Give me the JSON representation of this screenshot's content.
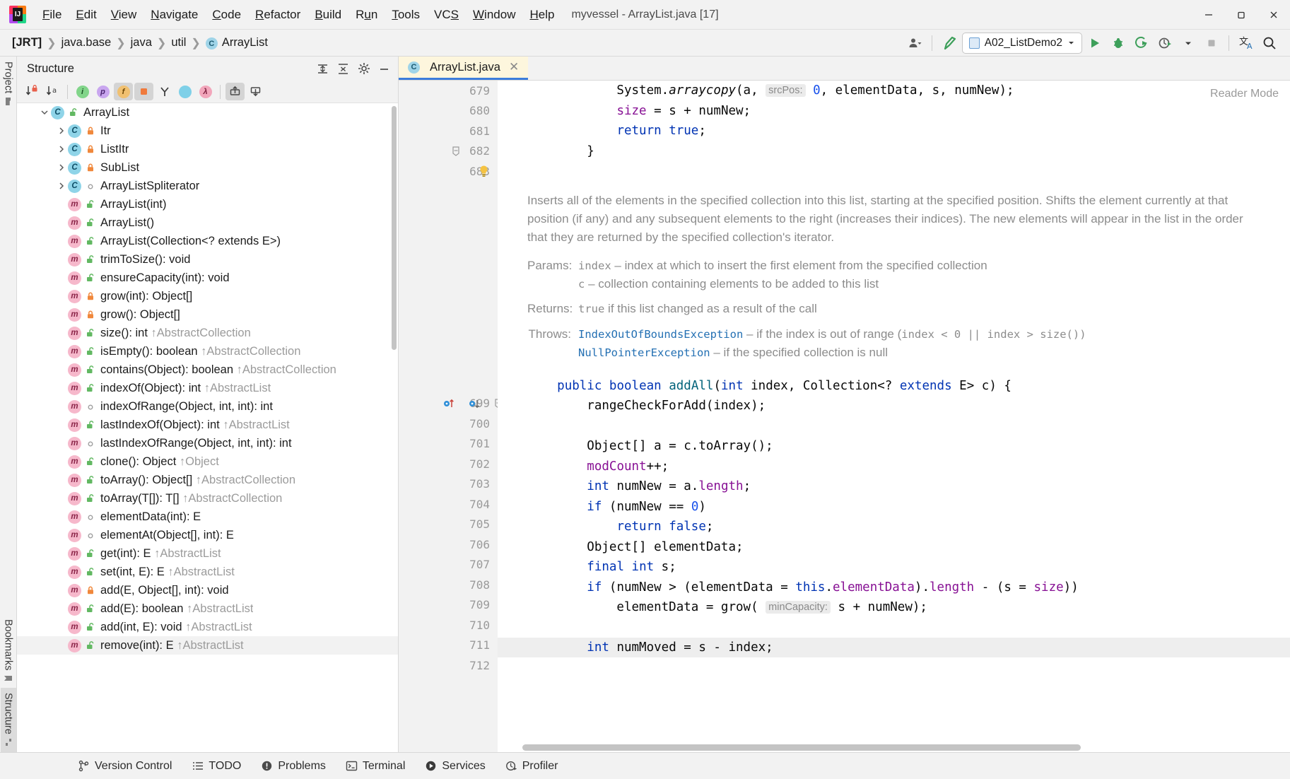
{
  "window": {
    "title": "myvessel - ArrayList.java [17]",
    "minimize": "minimize-icon",
    "restore": "restore-icon",
    "close": "close-icon"
  },
  "menubar": [
    {
      "label": "File",
      "mnemonic": "F"
    },
    {
      "label": "Edit",
      "mnemonic": "E"
    },
    {
      "label": "View",
      "mnemonic": "V"
    },
    {
      "label": "Navigate",
      "mnemonic": "N"
    },
    {
      "label": "Code",
      "mnemonic": "C"
    },
    {
      "label": "Refactor",
      "mnemonic": "R"
    },
    {
      "label": "Build",
      "mnemonic": "B"
    },
    {
      "label": "Run",
      "mnemonic": "u"
    },
    {
      "label": "Tools",
      "mnemonic": "T"
    },
    {
      "label": "VCS",
      "mnemonic": "S"
    },
    {
      "label": "Window",
      "mnemonic": "W"
    },
    {
      "label": "Help",
      "mnemonic": "H"
    }
  ],
  "navbar": {
    "breadcrumbs": [
      "[JRT]",
      "java.base",
      "java",
      "util",
      "ArrayList"
    ],
    "class_badge": "C",
    "run_config": "A02_ListDemo2",
    "buttons": {
      "profile": "user-profile-icon",
      "build": "hammer-icon",
      "run": "run-icon",
      "debug": "debug-icon",
      "run_coverage": "run-with-coverage-icon",
      "profiler": "profiler-icon",
      "stop": "stop-icon",
      "translate": "translate-icon",
      "search": "search-icon"
    }
  },
  "rail": {
    "top": [
      {
        "label": "Project",
        "icon": "folder-icon"
      }
    ],
    "bottom": [
      {
        "label": "Bookmarks",
        "icon": "bookmark-icon"
      },
      {
        "label": "Structure",
        "icon": "structure-icon"
      }
    ]
  },
  "structure": {
    "title": "Structure",
    "header_buttons": [
      {
        "name": "expand-all-icon"
      },
      {
        "name": "collapse-all-icon"
      },
      {
        "name": "settings-gear-icon"
      },
      {
        "name": "hide-icon"
      }
    ],
    "toolbar": [
      {
        "name": "sort-by-visibility-icon",
        "selected": false
      },
      {
        "name": "sort-alphabetically-icon",
        "selected": false
      },
      {
        "name": "show-inherited-icon",
        "selected": false,
        "color": "green",
        "glyph": "i"
      },
      {
        "name": "show-properties-icon",
        "selected": false,
        "color": "purple",
        "glyph": "p"
      },
      {
        "name": "show-fields-icon",
        "selected": true,
        "color": "orange",
        "glyph": "f"
      },
      {
        "name": "show-non-public-icon",
        "selected": true,
        "color": "orange-sq",
        "glyph": ""
      },
      {
        "name": "group-by-type-icon",
        "selected": false
      },
      {
        "name": "show-anonymous-classes-icon",
        "selected": false,
        "color": "cyan",
        "glyph": ""
      },
      {
        "name": "show-lambdas-icon",
        "selected": false,
        "color": "pink",
        "glyph": "λ"
      },
      {
        "name": "scroll-from-source-icon",
        "selected": true
      },
      {
        "name": "scroll-to-source-icon",
        "selected": false
      }
    ],
    "tree": [
      {
        "depth": 0,
        "expander": "expanded",
        "kind": "class",
        "vis": "public",
        "label": "ArrayList",
        "sup": ""
      },
      {
        "depth": 1,
        "expander": "collapsed",
        "kind": "class",
        "vis": "private",
        "label": "Itr",
        "sup": ""
      },
      {
        "depth": 1,
        "expander": "collapsed",
        "kind": "class",
        "vis": "private",
        "label": "ListItr",
        "sup": ""
      },
      {
        "depth": 1,
        "expander": "collapsed",
        "kind": "class",
        "vis": "private",
        "label": "SubList",
        "sup": ""
      },
      {
        "depth": 1,
        "expander": "collapsed",
        "kind": "class",
        "vis": "package",
        "label": "ArrayListSpliterator",
        "sup": ""
      },
      {
        "depth": 1,
        "expander": "none",
        "kind": "method",
        "vis": "public",
        "label": "ArrayList(int)",
        "sup": ""
      },
      {
        "depth": 1,
        "expander": "none",
        "kind": "method",
        "vis": "public",
        "label": "ArrayList()",
        "sup": ""
      },
      {
        "depth": 1,
        "expander": "none",
        "kind": "method",
        "vis": "public",
        "label": "ArrayList(Collection<? extends E>)",
        "sup": ""
      },
      {
        "depth": 1,
        "expander": "none",
        "kind": "method",
        "vis": "public",
        "label": "trimToSize(): void",
        "sup": ""
      },
      {
        "depth": 1,
        "expander": "none",
        "kind": "method",
        "vis": "public",
        "label": "ensureCapacity(int): void",
        "sup": ""
      },
      {
        "depth": 1,
        "expander": "none",
        "kind": "method",
        "vis": "private",
        "label": "grow(int): Object[]",
        "sup": ""
      },
      {
        "depth": 1,
        "expander": "none",
        "kind": "method",
        "vis": "private",
        "label": "grow(): Object[]",
        "sup": ""
      },
      {
        "depth": 1,
        "expander": "none",
        "kind": "method",
        "vis": "public",
        "label": "size(): int",
        "sup": "↑AbstractCollection"
      },
      {
        "depth": 1,
        "expander": "none",
        "kind": "method",
        "vis": "public",
        "label": "isEmpty(): boolean",
        "sup": "↑AbstractCollection"
      },
      {
        "depth": 1,
        "expander": "none",
        "kind": "method",
        "vis": "public",
        "label": "contains(Object): boolean",
        "sup": "↑AbstractCollection"
      },
      {
        "depth": 1,
        "expander": "none",
        "kind": "method",
        "vis": "public",
        "label": "indexOf(Object): int",
        "sup": "↑AbstractList"
      },
      {
        "depth": 1,
        "expander": "none",
        "kind": "method",
        "vis": "package",
        "label": "indexOfRange(Object, int, int): int",
        "sup": ""
      },
      {
        "depth": 1,
        "expander": "none",
        "kind": "method",
        "vis": "public",
        "label": "lastIndexOf(Object): int",
        "sup": "↑AbstractList"
      },
      {
        "depth": 1,
        "expander": "none",
        "kind": "method",
        "vis": "package",
        "label": "lastIndexOfRange(Object, int, int): int",
        "sup": ""
      },
      {
        "depth": 1,
        "expander": "none",
        "kind": "method",
        "vis": "public",
        "label": "clone(): Object",
        "sup": "↑Object"
      },
      {
        "depth": 1,
        "expander": "none",
        "kind": "method",
        "vis": "public",
        "label": "toArray(): Object[]",
        "sup": "↑AbstractCollection"
      },
      {
        "depth": 1,
        "expander": "none",
        "kind": "method",
        "vis": "public",
        "label": "toArray(T[]): T[]",
        "sup": "↑AbstractCollection"
      },
      {
        "depth": 1,
        "expander": "none",
        "kind": "method",
        "vis": "package",
        "label": "elementData(int): E",
        "sup": ""
      },
      {
        "depth": 1,
        "expander": "none",
        "kind": "method",
        "vis": "package",
        "label": "elementAt(Object[], int): E",
        "sup": ""
      },
      {
        "depth": 1,
        "expander": "none",
        "kind": "method",
        "vis": "public",
        "label": "get(int): E",
        "sup": "↑AbstractList"
      },
      {
        "depth": 1,
        "expander": "none",
        "kind": "method",
        "vis": "public",
        "label": "set(int, E): E",
        "sup": "↑AbstractList"
      },
      {
        "depth": 1,
        "expander": "none",
        "kind": "method",
        "vis": "private",
        "label": "add(E, Object[], int): void",
        "sup": ""
      },
      {
        "depth": 1,
        "expander": "none",
        "kind": "method",
        "vis": "public",
        "label": "add(E): boolean",
        "sup": "↑AbstractList"
      },
      {
        "depth": 1,
        "expander": "none",
        "kind": "method",
        "vis": "public",
        "label": "add(int, E): void",
        "sup": "↑AbstractList"
      },
      {
        "depth": 1,
        "expander": "none",
        "kind": "method",
        "vis": "public",
        "label": "remove(int): E",
        "sup": "↑AbstractList"
      }
    ]
  },
  "editor": {
    "tab": {
      "label": "ArrayList.java",
      "badge": "C",
      "close": "close-icon"
    },
    "reader_mode": "Reader Mode",
    "top_lines": [
      {
        "num": "679",
        "tokens": [
          {
            "t": "            System.",
            "c": "plain"
          },
          {
            "t": "arraycopy",
            "c": "ital"
          },
          {
            "t": "(a, ",
            "c": "plain"
          },
          {
            "t": "srcPos:",
            "c": "hint"
          },
          {
            "t": " ",
            "c": "plain"
          },
          {
            "t": "0",
            "c": "num"
          },
          {
            "t": ", elementData, s, numNew);",
            "c": "plain"
          }
        ]
      },
      {
        "num": "680",
        "tokens": [
          {
            "t": "            ",
            "c": "plain"
          },
          {
            "t": "size",
            "c": "fld"
          },
          {
            "t": " = s + numNew;",
            "c": "plain"
          }
        ]
      },
      {
        "num": "681",
        "tokens": [
          {
            "t": "            ",
            "c": "plain"
          },
          {
            "t": "return",
            "c": "kw"
          },
          {
            "t": " ",
            "c": "plain"
          },
          {
            "t": "true",
            "c": "kw"
          },
          {
            "t": ";",
            "c": "plain"
          }
        ]
      },
      {
        "num": "682",
        "tokens": [
          {
            "t": "        }",
            "c": "plain"
          }
        ],
        "fold": true
      },
      {
        "num": "683",
        "tokens": [
          {
            "t": "",
            "c": "plain"
          }
        ],
        "bulb": true
      }
    ],
    "doc": {
      "paragraph": "Inserts all of the elements in the specified collection into this list, starting at the specified position. Shifts the element currently at that position (if any) and any subsequent elements to the right (increases their indices). The new elements will appear in the list in the order that they are returned by the specified collection's iterator.",
      "params_label": "Params:",
      "params": [
        {
          "name": "index",
          "desc": "– index at which to insert the first element from the specified collection"
        },
        {
          "name": "c",
          "desc": "– collection containing elements to be added to this list"
        }
      ],
      "returns_label": "Returns:",
      "returns_code": "true",
      "returns_desc": " if this list changed as a result of the call",
      "throws_label": "Throws:",
      "throws": [
        {
          "type": "IndexOutOfBoundsException",
          "desc": "– if the index is out of range (",
          "code1": "index < 0 || index > size()"
        },
        {
          "type": "NullPointerException",
          "desc": "– if the specified collection is null",
          "code1": ""
        }
      ]
    },
    "code_lines": [
      {
        "num": "699",
        "gutter": [
          "impl-up-marker",
          "impl-down-marker",
          "fold-marker"
        ],
        "tokens": [
          {
            "t": "    ",
            "c": "plain"
          },
          {
            "t": "public",
            "c": "kw"
          },
          {
            "t": " ",
            "c": "plain"
          },
          {
            "t": "boolean",
            "c": "kw"
          },
          {
            "t": " ",
            "c": "plain"
          },
          {
            "t": "addAll",
            "c": "mth"
          },
          {
            "t": "(",
            "c": "plain"
          },
          {
            "t": "int",
            "c": "kw"
          },
          {
            "t": " index, Collection<? ",
            "c": "plain"
          },
          {
            "t": "extends",
            "c": "kw"
          },
          {
            "t": " E> c) {",
            "c": "plain"
          }
        ]
      },
      {
        "num": "700",
        "tokens": [
          {
            "t": "        rangeCheckForAdd(index);",
            "c": "plain"
          }
        ]
      },
      {
        "num": "701",
        "tokens": [
          {
            "t": "",
            "c": "plain"
          }
        ]
      },
      {
        "num": "702",
        "tokens": [
          {
            "t": "        Object[] a = c.toArray();",
            "c": "plain"
          }
        ]
      },
      {
        "num": "703",
        "tokens": [
          {
            "t": "        ",
            "c": "plain"
          },
          {
            "t": "modCount",
            "c": "fld"
          },
          {
            "t": "++;",
            "c": "plain"
          }
        ]
      },
      {
        "num": "704",
        "tokens": [
          {
            "t": "        ",
            "c": "plain"
          },
          {
            "t": "int",
            "c": "kw"
          },
          {
            "t": " numNew = a.",
            "c": "plain"
          },
          {
            "t": "length",
            "c": "fld"
          },
          {
            "t": ";",
            "c": "plain"
          }
        ]
      },
      {
        "num": "705",
        "tokens": [
          {
            "t": "        ",
            "c": "plain"
          },
          {
            "t": "if",
            "c": "kw"
          },
          {
            "t": " (numNew == ",
            "c": "plain"
          },
          {
            "t": "0",
            "c": "num"
          },
          {
            "t": ")",
            "c": "plain"
          }
        ]
      },
      {
        "num": "706",
        "tokens": [
          {
            "t": "            ",
            "c": "plain"
          },
          {
            "t": "return",
            "c": "kw"
          },
          {
            "t": " ",
            "c": "plain"
          },
          {
            "t": "false",
            "c": "kw"
          },
          {
            "t": ";",
            "c": "plain"
          }
        ]
      },
      {
        "num": "707",
        "tokens": [
          {
            "t": "        Object[] elementData;",
            "c": "plain"
          }
        ]
      },
      {
        "num": "708",
        "tokens": [
          {
            "t": "        ",
            "c": "plain"
          },
          {
            "t": "final",
            "c": "kw"
          },
          {
            "t": " ",
            "c": "plain"
          },
          {
            "t": "int",
            "c": "kw"
          },
          {
            "t": " s;",
            "c": "plain"
          }
        ]
      },
      {
        "num": "709",
        "tokens": [
          {
            "t": "        ",
            "c": "plain"
          },
          {
            "t": "if",
            "c": "kw"
          },
          {
            "t": " (numNew > (elementData = ",
            "c": "plain"
          },
          {
            "t": "this",
            "c": "kw"
          },
          {
            "t": ".",
            "c": "plain"
          },
          {
            "t": "elementData",
            "c": "fld"
          },
          {
            "t": ").",
            "c": "plain"
          },
          {
            "t": "length",
            "c": "fld"
          },
          {
            "t": " - (s = ",
            "c": "plain"
          },
          {
            "t": "size",
            "c": "fld"
          },
          {
            "t": "))",
            "c": "plain"
          }
        ]
      },
      {
        "num": "710",
        "tokens": [
          {
            "t": "            elementData = grow( ",
            "c": "plain"
          },
          {
            "t": "minCapacity:",
            "c": "hint"
          },
          {
            "t": " s + numNew);",
            "c": "plain"
          }
        ]
      },
      {
        "num": "711",
        "tokens": [
          {
            "t": "",
            "c": "plain"
          }
        ]
      },
      {
        "num": "712",
        "highlight": true,
        "tokens": [
          {
            "t": "        ",
            "c": "plain"
          },
          {
            "t": "int",
            "c": "kw"
          },
          {
            "t": " numMoved = s - index;",
            "c": "plain"
          }
        ]
      }
    ]
  },
  "statusbar": [
    {
      "label": "Version Control",
      "icon": "branch-icon"
    },
    {
      "label": "TODO",
      "icon": "todo-list-icon"
    },
    {
      "label": "Problems",
      "icon": "problems-icon"
    },
    {
      "label": "Terminal",
      "icon": "terminal-icon"
    },
    {
      "label": "Services",
      "icon": "services-icon"
    },
    {
      "label": "Profiler",
      "icon": "profiler-icon"
    }
  ]
}
